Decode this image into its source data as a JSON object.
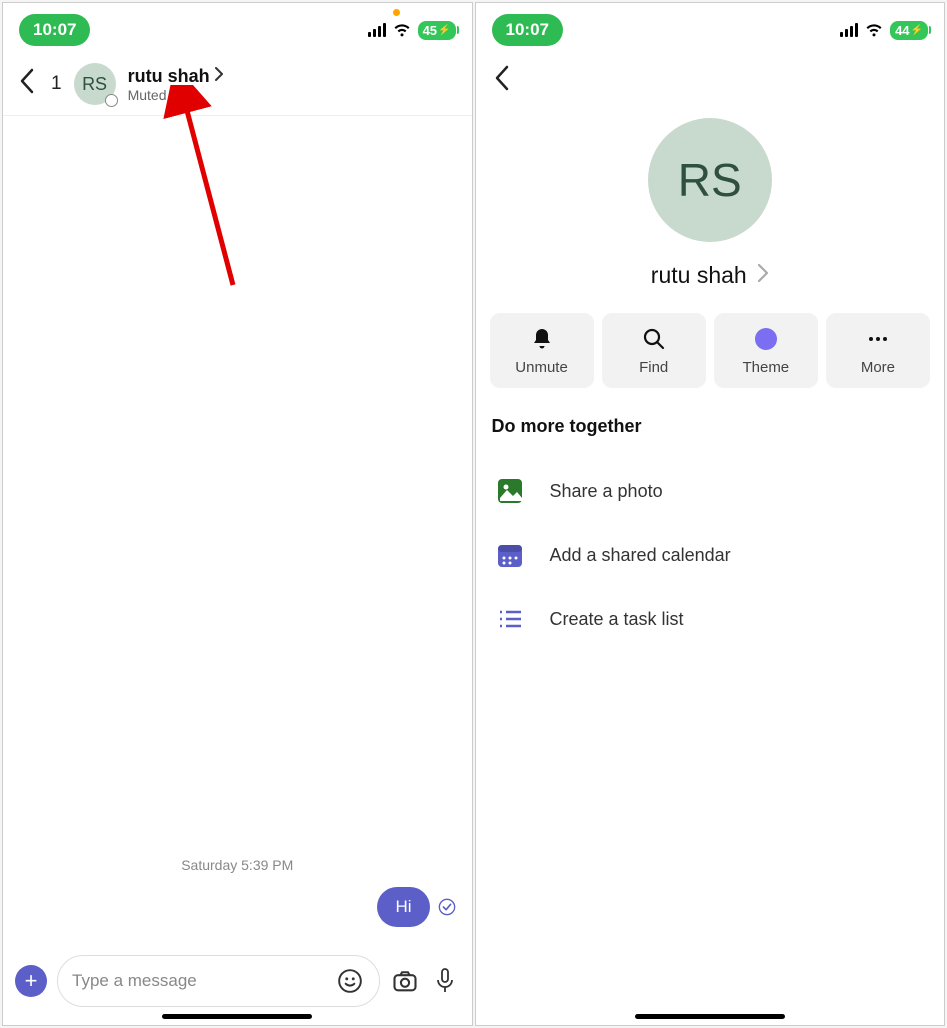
{
  "left": {
    "status": {
      "time": "10:07",
      "battery": "45"
    },
    "header": {
      "count": "1",
      "avatar_initials": "RS",
      "name": "rutu shah",
      "subtitle": "Muted"
    },
    "timestamp": "Saturday 5:39 PM",
    "message": {
      "text": "Hi"
    },
    "input": {
      "placeholder": "Type a message"
    }
  },
  "right": {
    "status": {
      "time": "10:07",
      "battery": "44"
    },
    "avatar_initials": "RS",
    "name": "rutu shah",
    "actions": {
      "unmute": "Unmute",
      "find": "Find",
      "theme": "Theme",
      "more": "More"
    },
    "section_title": "Do more together",
    "items": {
      "photo": "Share a photo",
      "calendar": "Add a shared calendar",
      "tasks": "Create a task list"
    }
  }
}
